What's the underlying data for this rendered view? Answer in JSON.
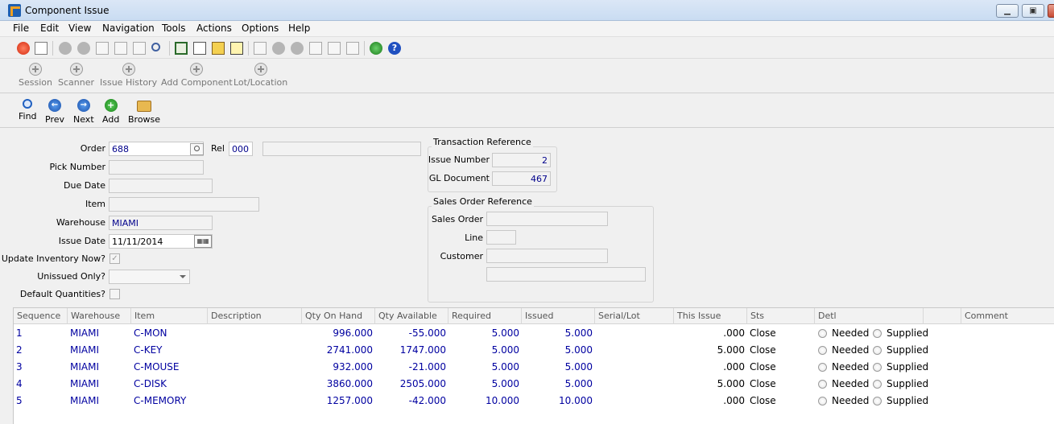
{
  "window": {
    "title": "Component Issue"
  },
  "menu": [
    "File",
    "Edit",
    "View",
    "Navigation",
    "Tools",
    "Actions",
    "Options",
    "Help"
  ],
  "ribbon": [
    {
      "label": "Session"
    },
    {
      "label": "Scanner"
    },
    {
      "label": "Issue History"
    },
    {
      "label": "Add Component"
    },
    {
      "label": "Lot/Location"
    }
  ],
  "nav": [
    {
      "label": "Find",
      "icon": "search-icon"
    },
    {
      "label": "Prev",
      "icon": "arrow-left-icon"
    },
    {
      "label": "Next",
      "icon": "arrow-right-icon"
    },
    {
      "label": "Add",
      "icon": "plus-icon"
    },
    {
      "label": "Browse",
      "icon": "folder-icon"
    }
  ],
  "form": {
    "order_label": "Order",
    "order_value": "688",
    "rel_label": "Rel",
    "rel_value": "000",
    "pick_label": "Pick Number",
    "pick_value": "",
    "due_label": "Due Date",
    "due_value": "",
    "item_label": "Item",
    "item_value": "",
    "warehouse_label": "Warehouse",
    "warehouse_value": "MIAMI",
    "issue_date_label": "Issue Date",
    "issue_date_value": "11/11/2014",
    "update_inv_label": "Update Inventory Now?",
    "update_inv_checked": true,
    "unissued_label": "Unissued Only?",
    "unissued_value": "",
    "default_qty_label": "Default Quantities?"
  },
  "transaction_ref": {
    "title": "Transaction Reference",
    "issue_number_label": "Issue Number",
    "issue_number_value": "2",
    "gl_document_label": "GL Document",
    "gl_document_value": "467"
  },
  "sales_order_ref": {
    "title": "Sales Order Reference",
    "sales_order_label": "Sales Order",
    "sales_order_value": "",
    "line_label": "Line",
    "line_value": "",
    "customer_label": "Customer",
    "customer_value": "",
    "customer_name": ""
  },
  "grid": {
    "columns": [
      "Sequence",
      "Warehouse",
      "Item",
      "Description",
      "Qty On Hand",
      "Qty Available",
      "Required",
      "Issued",
      "Serial/Lot",
      "This Issue",
      "Sts",
      "Detl",
      "",
      "Comment"
    ],
    "needed_label": "Needed",
    "supplied_label": "Supplied",
    "rows": [
      {
        "seq": "1",
        "warehouse": "MIAMI",
        "item": "C-MON",
        "description": "",
        "on_hand": "996.000",
        "available": "-55.000",
        "required": "5.000",
        "issued": "5.000",
        "serial": "",
        "this_issue": ".000",
        "sts": "Close"
      },
      {
        "seq": "2",
        "warehouse": "MIAMI",
        "item": "C-KEY",
        "description": "",
        "on_hand": "2741.000",
        "available": "1747.000",
        "required": "5.000",
        "issued": "5.000",
        "serial": "",
        "this_issue": "5.000",
        "sts": "Close"
      },
      {
        "seq": "3",
        "warehouse": "MIAMI",
        "item": "C-MOUSE",
        "description": "",
        "on_hand": "932.000",
        "available": "-21.000",
        "required": "5.000",
        "issued": "5.000",
        "serial": "",
        "this_issue": ".000",
        "sts": "Close"
      },
      {
        "seq": "4",
        "warehouse": "MIAMI",
        "item": "C-DISK",
        "description": "",
        "on_hand": "3860.000",
        "available": "2505.000",
        "required": "5.000",
        "issued": "5.000",
        "serial": "",
        "this_issue": "5.000",
        "sts": "Close"
      },
      {
        "seq": "5",
        "warehouse": "MIAMI",
        "item": "C-MEMORY",
        "description": "",
        "on_hand": "1257.000",
        "available": "-42.000",
        "required": "10.000",
        "issued": "10.000",
        "serial": "",
        "this_issue": ".000",
        "sts": "Close"
      }
    ]
  }
}
